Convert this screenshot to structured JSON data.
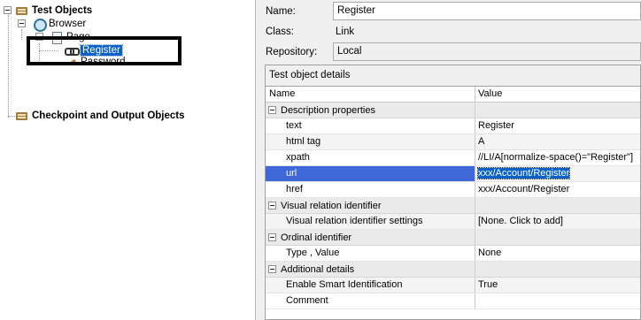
{
  "tree": {
    "root_label": "Test Objects",
    "browser_label": "Browser",
    "page_label": "Page",
    "register_label": "Register",
    "password_label": "Password",
    "checkpoint_label": "Checkpoint and Output Objects"
  },
  "fields": {
    "name_label": "Name:",
    "name_value": "Register",
    "class_label": "Class:",
    "class_value": "Link",
    "repository_label": "Repository:",
    "repository_value": "Local"
  },
  "details": {
    "caption": "Test object details",
    "header_name": "Name",
    "header_value": "Value",
    "categories": [
      {
        "label": "Description properties",
        "rows": [
          {
            "name": "text",
            "value": "Register"
          },
          {
            "name": "html tag",
            "value": "A"
          },
          {
            "name": "xpath",
            "value": "//LI/A[normalize-space()=\"Register\"]"
          },
          {
            "name": "url",
            "value": "xxx/Account/Register",
            "selected": true
          },
          {
            "name": "href",
            "value": "xxx/Account/Register"
          }
        ]
      },
      {
        "label": "Visual relation identifier",
        "rows": [
          {
            "name": "Visual relation identifier settings",
            "value": "[None. Click to add]"
          }
        ]
      },
      {
        "label": "Ordinal identifier",
        "rows": [
          {
            "name": "Type , Value",
            "value": "None"
          }
        ]
      },
      {
        "label": "Additional details",
        "rows": [
          {
            "name": "Enable Smart Identification",
            "value": "True"
          },
          {
            "name": "Comment",
            "value": ""
          }
        ]
      }
    ]
  },
  "icons": {
    "root": "folder-icon",
    "browser": "browser-icon",
    "page": "page-icon",
    "register": "link-icon",
    "password": "edit-icon",
    "checkpoint": "folder-icon"
  },
  "colors": {
    "selection": "#0a62c8",
    "row_selection": "#3e67d8",
    "panel_bg": "#f0f0f0"
  }
}
